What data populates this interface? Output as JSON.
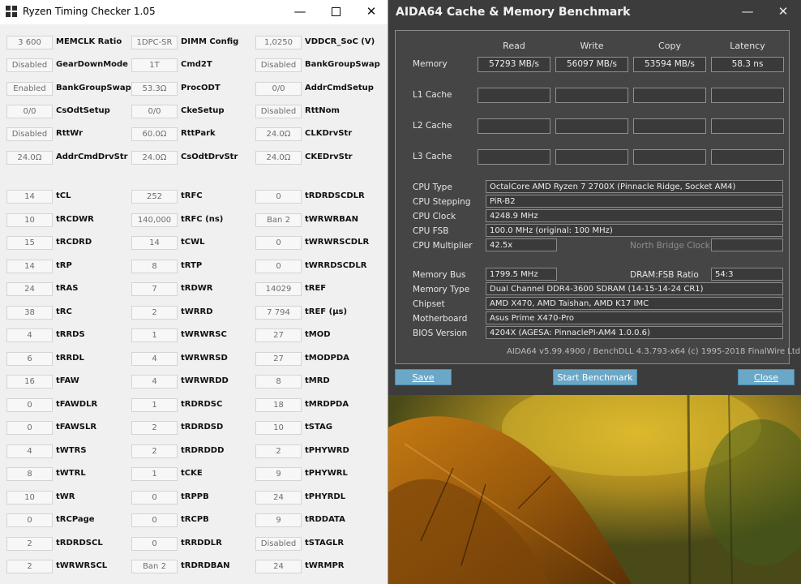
{
  "rtc": {
    "title": "Ryzen Timing Checker 1.05",
    "group1": [
      [
        {
          "label": "MEMCLK Ratio",
          "value": "3 600"
        },
        {
          "label": "DIMM Config",
          "value": "1DPC-SR"
        },
        {
          "label": "VDDCR_SoC (V)",
          "value": "1,0250"
        }
      ],
      [
        {
          "label": "GearDownMode",
          "value": "Disabled"
        },
        {
          "label": "Cmd2T",
          "value": "1T"
        },
        {
          "label": "BankGroupSwap",
          "value": "Disabled"
        }
      ],
      [
        {
          "label": "BankGroupSwapAlt",
          "value": "Enabled"
        },
        {
          "label": "ProcODT",
          "value": "53.3Ω"
        },
        {
          "label": "AddrCmdSetup",
          "value": "0/0"
        }
      ],
      [
        {
          "label": "CsOdtSetup",
          "value": "0/0"
        },
        {
          "label": "CkeSetup",
          "value": "0/0"
        },
        {
          "label": "RttNom",
          "value": "Disabled"
        }
      ],
      [
        {
          "label": "RttWr",
          "value": "Disabled"
        },
        {
          "label": "RttPark",
          "value": "60.0Ω"
        },
        {
          "label": "CLKDrvStr",
          "value": "24.0Ω"
        }
      ],
      [
        {
          "label": "AddrCmdDrvStr",
          "value": "24.0Ω"
        },
        {
          "label": "CsOdtDrvStr",
          "value": "24.0Ω"
        },
        {
          "label": "CKEDrvStr",
          "value": "24.0Ω"
        }
      ]
    ],
    "group2": [
      [
        {
          "label": "tCL",
          "value": "14"
        },
        {
          "label": "tRFC",
          "value": "252"
        },
        {
          "label": "tRDRDSCDLR",
          "value": "0"
        }
      ],
      [
        {
          "label": "tRCDWR",
          "value": "10"
        },
        {
          "label": "tRFC (ns)",
          "value": "140,000"
        },
        {
          "label": "tWRWRBAN",
          "value": "Ban 2"
        }
      ],
      [
        {
          "label": "tRCDRD",
          "value": "15"
        },
        {
          "label": "tCWL",
          "value": "14"
        },
        {
          "label": "tWRWRSCDLR",
          "value": "0"
        }
      ],
      [
        {
          "label": "tRP",
          "value": "14"
        },
        {
          "label": "tRTP",
          "value": "8"
        },
        {
          "label": "tWRRDSCDLR",
          "value": "0"
        }
      ],
      [
        {
          "label": "tRAS",
          "value": "24"
        },
        {
          "label": "tRDWR",
          "value": "7"
        },
        {
          "label": "tREF",
          "value": "14029"
        }
      ],
      [
        {
          "label": "tRC",
          "value": "38"
        },
        {
          "label": "tWRRD",
          "value": "2"
        },
        {
          "label": "tREF (µs)",
          "value": "7 794"
        }
      ],
      [
        {
          "label": "tRRDS",
          "value": "4"
        },
        {
          "label": "tWRWRSC",
          "value": "1"
        },
        {
          "label": "tMOD",
          "value": "27"
        }
      ],
      [
        {
          "label": "tRRDL",
          "value": "6"
        },
        {
          "label": "tWRWRSD",
          "value": "4"
        },
        {
          "label": "tMODPDA",
          "value": "27"
        }
      ],
      [
        {
          "label": "tFAW",
          "value": "16"
        },
        {
          "label": "tWRWRDD",
          "value": "4"
        },
        {
          "label": "tMRD",
          "value": "8"
        }
      ],
      [
        {
          "label": "tFAWDLR",
          "value": "0"
        },
        {
          "label": "tRDRDSC",
          "value": "1"
        },
        {
          "label": "tMRDPDA",
          "value": "18"
        }
      ],
      [
        {
          "label": "tFAWSLR",
          "value": "0"
        },
        {
          "label": "tRDRDSD",
          "value": "2"
        },
        {
          "label": "tSTAG",
          "value": "10"
        }
      ],
      [
        {
          "label": "tWTRS",
          "value": "4"
        },
        {
          "label": "tRDRDDD",
          "value": "2"
        },
        {
          "label": "tPHYWRD",
          "value": "2"
        }
      ],
      [
        {
          "label": "tWTRL",
          "value": "8"
        },
        {
          "label": "tCKE",
          "value": "1"
        },
        {
          "label": "tPHYWRL",
          "value": "9"
        }
      ],
      [
        {
          "label": "tWR",
          "value": "10"
        },
        {
          "label": "tRPPB",
          "value": "0"
        },
        {
          "label": "tPHYRDL",
          "value": "24"
        }
      ],
      [
        {
          "label": "tRCPage",
          "value": "0"
        },
        {
          "label": "tRCPB",
          "value": "0"
        },
        {
          "label": "tRDDATA",
          "value": "9"
        }
      ],
      [
        {
          "label": "tRDRDSCL",
          "value": "2"
        },
        {
          "label": "tRRDDLR",
          "value": "0"
        },
        {
          "label": "tSTAGLR",
          "value": "Disabled"
        }
      ],
      [
        {
          "label": "tWRWRSCL",
          "value": "2"
        },
        {
          "label": "tRDRDBAN",
          "value": "Ban 2"
        },
        {
          "label": "tWRMPR",
          "value": "24"
        }
      ]
    ]
  },
  "aida": {
    "title": "AIDA64 Cache & Memory Benchmark",
    "headers": {
      "read": "Read",
      "write": "Write",
      "copy": "Copy",
      "latency": "Latency"
    },
    "rows": [
      {
        "label": "Memory",
        "read": "57293 MB/s",
        "write": "56097 MB/s",
        "copy": "53594 MB/s",
        "latency": "58.3 ns"
      },
      {
        "label": "L1 Cache",
        "read": "",
        "write": "",
        "copy": "",
        "latency": ""
      },
      {
        "label": "L2 Cache",
        "read": "",
        "write": "",
        "copy": "",
        "latency": ""
      },
      {
        "label": "L3 Cache",
        "read": "",
        "write": "",
        "copy": "",
        "latency": ""
      }
    ],
    "info": {
      "cpu_type_label": "CPU Type",
      "cpu_type": "OctalCore AMD Ryzen 7 2700X  (Pinnacle Ridge, Socket AM4)",
      "cpu_stepping_label": "CPU Stepping",
      "cpu_stepping": "PiR-B2",
      "cpu_clock_label": "CPU Clock",
      "cpu_clock": "4248.9 MHz",
      "cpu_fsb_label": "CPU FSB",
      "cpu_fsb": "100.0 MHz  (original: 100 MHz)",
      "cpu_mult_label": "CPU Multiplier",
      "cpu_mult": "42.5x",
      "nb_clock_label": "North Bridge Clock",
      "nb_clock": "",
      "mem_bus_label": "Memory Bus",
      "mem_bus": "1799.5 MHz",
      "dram_fsb_label": "DRAM:FSB Ratio",
      "dram_fsb": "54:3",
      "mem_type_label": "Memory Type",
      "mem_type": "Dual Channel DDR4-3600 SDRAM  (14-15-14-24 CR1)",
      "chipset_label": "Chipset",
      "chipset": "AMD X470, AMD Taishan, AMD K17 IMC",
      "mobo_label": "Motherboard",
      "mobo": "Asus Prime X470-Pro",
      "bios_label": "BIOS Version",
      "bios": "4204X  (AGESA: PinnaclePI-AM4 1.0.0.6)"
    },
    "footer": "AIDA64 v5.99.4900 / BenchDLL 4.3.793-x64  (c) 1995-2018 FinalWire Ltd.",
    "buttons": {
      "save": "Save",
      "start": "Start Benchmark",
      "close": "Close"
    }
  },
  "icons": {
    "minimize": "minimize-icon",
    "maximize": "maximize-icon",
    "close": "close-icon",
    "app": "app-icon"
  }
}
